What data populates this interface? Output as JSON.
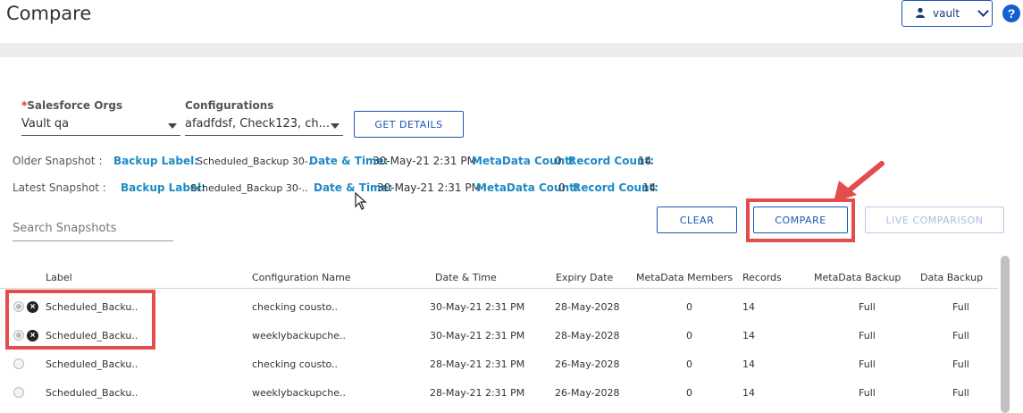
{
  "header": {
    "title": "Compare",
    "user_label": "vault"
  },
  "filters": {
    "org_label": "Salesforce Orgs",
    "org_required": "*",
    "org_value": "Vault qa",
    "config_label": "Configurations",
    "config_value": "afadfdsf, Check123, ch...",
    "get_details": "GET DETAILS"
  },
  "older": {
    "title": "Older Snapshot :",
    "backup_label": "Backup Label:",
    "backup_value": "Scheduled_Backup 30-..",
    "datetime_label": "Date & Time:",
    "datetime_value": "30-May-21 2:31 PM",
    "metadata_label": "MetaData Count:",
    "metadata_value": "0",
    "record_label": "Record Count:",
    "record_value": "14"
  },
  "latest": {
    "title": "Latest Snapshot :",
    "backup_label": "Backup Label:",
    "backup_value": "Scheduled_Backup 30-..",
    "datetime_label": "Date & Time:",
    "datetime_value": "30-May-21 2:31 PM",
    "metadata_label": "MetaData Count:",
    "metadata_value": "0",
    "record_label": "Record Count:",
    "record_value": "14"
  },
  "search": {
    "placeholder": "Search Snapshots"
  },
  "actions": {
    "clear": "CLEAR",
    "compare": "COMPARE",
    "live": "LIVE COMPARISON"
  },
  "table": {
    "columns": [
      "Label",
      "Configuration Name",
      "Date & Time",
      "Expiry Date",
      "MetaData Members",
      "Records",
      "MetaData Backup",
      "Data Backup"
    ],
    "rows": [
      {
        "label": "Scheduled_Backu..",
        "config": "checking cousto..",
        "datetime": "30-May-21 2:31 PM",
        "expiry": "28-May-2028",
        "members": "0",
        "records": "14",
        "md_backup": "Full",
        "data_backup": "Full",
        "selected": true
      },
      {
        "label": "Scheduled_Backu..",
        "config": "weeklybackupche..",
        "datetime": "30-May-21 2:31 PM",
        "expiry": "28-May-2028",
        "members": "0",
        "records": "14",
        "md_backup": "Full",
        "data_backup": "Full",
        "selected": true
      },
      {
        "label": "Scheduled_Backu..",
        "config": "checking cousto..",
        "datetime": "28-May-21 2:31 PM",
        "expiry": "26-May-2028",
        "members": "0",
        "records": "14",
        "md_backup": "Full",
        "data_backup": "Full",
        "selected": false
      },
      {
        "label": "Scheduled_Backu..",
        "config": "weeklybackupche..",
        "datetime": "28-May-21 2:31 PM",
        "expiry": "26-May-2028",
        "members": "0",
        "records": "14",
        "md_backup": "Full",
        "data_backup": "Full",
        "selected": false
      }
    ]
  },
  "colors": {
    "accent": "#1a56b4",
    "label_blue": "#1e8ac4",
    "highlight": "#e44d4d"
  }
}
